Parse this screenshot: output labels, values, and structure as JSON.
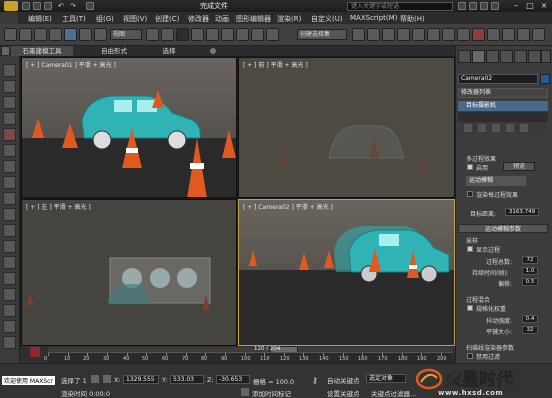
{
  "titlebar": {
    "doc_title": "完成文件",
    "search_placeholder": "键入关键字或短语"
  },
  "menubar": {
    "items": [
      "编辑(E)",
      "工具(T)",
      "组(G)",
      "视图(V)",
      "创建(C)",
      "修改器",
      "动画",
      "图形编辑器",
      "渲染(R)",
      "自定义(U)",
      "MAXScript(M)",
      "帮助(H)"
    ]
  },
  "toolbar": {
    "view_dropdown": "视图",
    "selection_set": "创建选择集"
  },
  "ribbon": {
    "tabs": [
      "石墨建模工具",
      "自由形式",
      "选择"
    ]
  },
  "viewports": {
    "top_left": "[ + ] Camera01 ] 平滑 + 高光 ]",
    "top_right": "[ + ] 前 ] 平滑 + 高光 ]",
    "bottom_left": "[ + ] 左 ] 平滑 + 高光 ]",
    "bottom_right": "[ + ] Camera02 ] 平滑 + 高光 ]"
  },
  "command_panel": {
    "object_name": "Camera02",
    "modifier_list": "修改器列表",
    "stack_item": "目标摄影机",
    "multipass_title": "多过程效果",
    "enable_label": "启用",
    "preview_button": "预览",
    "effect_dropdown": "运动模糊",
    "render_each_label": "渲染每过程效果",
    "target_distance_label": "目标距离:",
    "target_distance_value": "3163.749",
    "motion_blur_params": "运动模糊参数",
    "sampling_title": "采样",
    "display_passes_label": "显示过程",
    "total_passes_label": "过程总数:",
    "total_passes_value": "72",
    "duration_label": "持续时间(帧):",
    "duration_value": "1.0",
    "bias_label": "偏移:",
    "bias_value": "0.5",
    "pass_blending_title": "过程混合",
    "normalize_weights_label": "规格化权重",
    "dither_strength_label": "抖动强度:",
    "dither_strength_value": "0.4",
    "tile_size_label": "平铺大小:",
    "tile_size_value": "32",
    "scanline_params_title": "扫描线渲染器参数",
    "disable_filtering_label": "禁用过滤"
  },
  "timeline": {
    "frame_counter": "120 / 204",
    "ticks": [
      "0",
      "10",
      "20",
      "30",
      "40",
      "50",
      "60",
      "70",
      "80",
      "90",
      "100",
      "110",
      "120",
      "130",
      "140",
      "150",
      "160",
      "170",
      "180",
      "190",
      "200"
    ],
    "progress": 0.588
  },
  "bottombar": {
    "welcome": "欢迎使用 MAXScr",
    "selected_label": "选择了 1",
    "x_label": "X:",
    "x_value": "1329.555",
    "y_label": "Y:",
    "y_value": "533.03",
    "z_label": "Z:",
    "z_value": "-30.653",
    "grid_label": "栅格 = 100.0",
    "auto_key_label": "自动关键点",
    "selected_obj": "选定对象",
    "set_key_label": "设置关键点",
    "key_filter_label": "关键点过滤器...",
    "render_time_label": "渲染时间 0:00:0",
    "add_time_tag": "添加时间标记"
  },
  "watermark": {
    "logo_text": "火星时代",
    "url": "www.hxsd.com"
  },
  "colors": {
    "car": "#2fb3b5",
    "cone_orange": "#e05a20",
    "active_border": "#c0a040",
    "accent_blue": "#4f6f93"
  }
}
